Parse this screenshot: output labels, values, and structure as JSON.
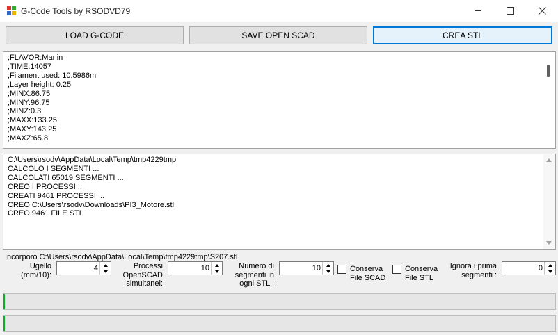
{
  "window": {
    "title": "G-Code Tools by RSODVD79"
  },
  "toolbar": {
    "load_label": "LOAD G-CODE",
    "save_label": "SAVE OPEN SCAD",
    "crea_label": "CREA STL"
  },
  "gcode_lines": [
    ";FLAVOR:Marlin",
    ";TIME:14057",
    ";Filament used: 10.5986m",
    ";Layer height: 0.25",
    ";MINX:86.75",
    ";MINY:96.75",
    ";MINZ:0.3",
    ";MAXX:133.25",
    ";MAXY:143.25",
    ";MAXZ:65.8"
  ],
  "log_lines": [
    "C:\\Users\\rsodv\\AppData\\Local\\Temp\\tmp4229tmp",
    "CALCOLO I SEGMENTI ...",
    "CALCOLATI 65019 SEGMENTI ...",
    "CREO I PROCESSI ...",
    "CREATI 9461 PROCESSI ...",
    "CREO C:\\Users\\rsodv\\Downloads\\PI3_Motore.stl",
    "CREO 9461 FILE STL"
  ],
  "status_text": "Incorporo C:\\Users\\rsodv\\AppData\\Local\\Temp\\tmp4229tmp\\S207.stl",
  "options": {
    "ugello": {
      "label_1": "Ugello",
      "label_2": "(mm/10):",
      "value": "4"
    },
    "processi": {
      "label_1": "Processi",
      "label_2": "OpenSCAD",
      "label_3": "simultanei:",
      "value": "10"
    },
    "segmenti": {
      "label_1": "Numero di",
      "label_2": "segmenti in",
      "label_3": "ogni STL :",
      "value": "10"
    },
    "conserva_scad": {
      "label_1": "Conserva",
      "label_2": "File SCAD",
      "checked": false
    },
    "conserva_stl": {
      "label_1": "Conserva",
      "label_2": "File STL",
      "checked": false
    },
    "ignora": {
      "label_1": "Ignora i prima",
      "label_2": "segmenti :",
      "value": "0"
    }
  },
  "progress": {
    "bar1": 0.003,
    "bar2": 0.003
  },
  "colors": {
    "accent": "#0078d7",
    "progress": "#06b025"
  }
}
